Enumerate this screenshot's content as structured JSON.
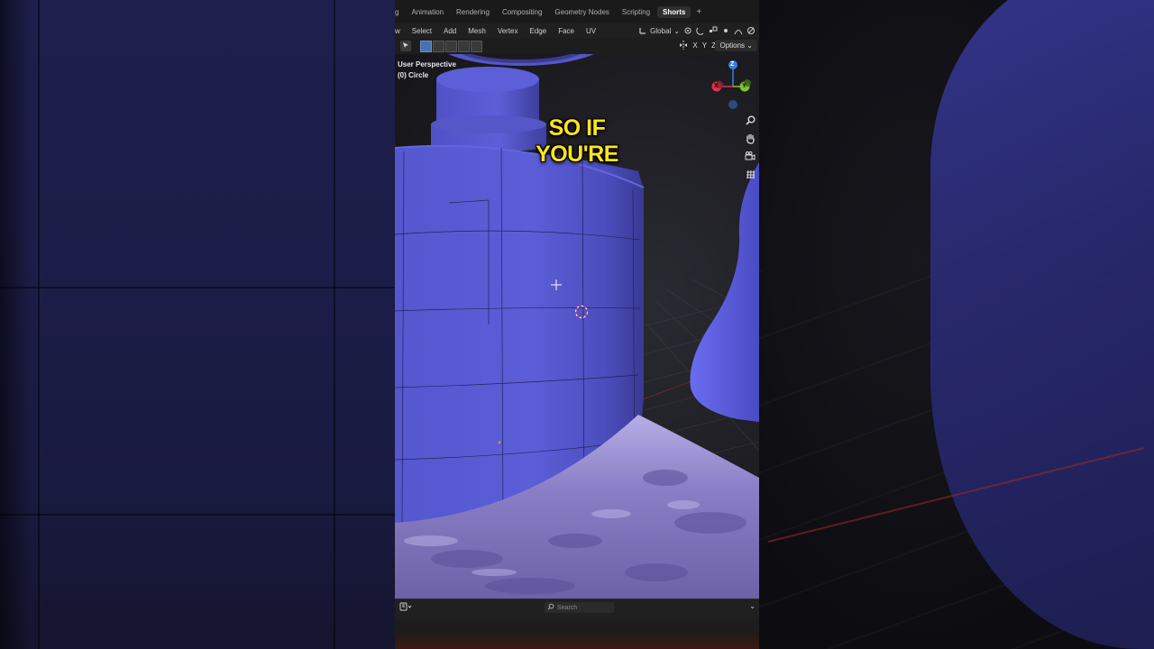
{
  "workspace_tabs": [
    {
      "label": "g",
      "active": false
    },
    {
      "label": "Animation",
      "active": false
    },
    {
      "label": "Rendering",
      "active": false
    },
    {
      "label": "Compositing",
      "active": false
    },
    {
      "label": "Geometry Nodes",
      "active": false
    },
    {
      "label": "Scripting",
      "active": false
    },
    {
      "label": "Shorts",
      "active": true
    }
  ],
  "add_tab_symbol": "+",
  "menu": [
    "w",
    "Select",
    "Add",
    "Mesh",
    "Vertex",
    "Edge",
    "Face",
    "UV"
  ],
  "transform_orientation": "Global",
  "axes": {
    "x": "X",
    "y": "Y",
    "z": "Z"
  },
  "options_label": "Options",
  "viewport": {
    "view_name": "User Perspective",
    "object_name": "(0) Circle"
  },
  "gizmo": {
    "x": "X",
    "y": "Y",
    "z": "Z"
  },
  "subtitle": "SO IF YOU'RE",
  "search_placeholder": "Search",
  "icons": [
    "zoom-icon",
    "hand-pan-icon",
    "camera-icon",
    "grid-ortho-icon",
    "search-icon",
    "editor-type-icon"
  ],
  "colors": {
    "mesh": "#5b5dd6",
    "subtitle": "#ffe51a",
    "active_tab": "#2f2f2f",
    "gizmo_x": "#e0344a",
    "gizmo_y": "#7ec228",
    "gizmo_z": "#3b7fe0"
  }
}
